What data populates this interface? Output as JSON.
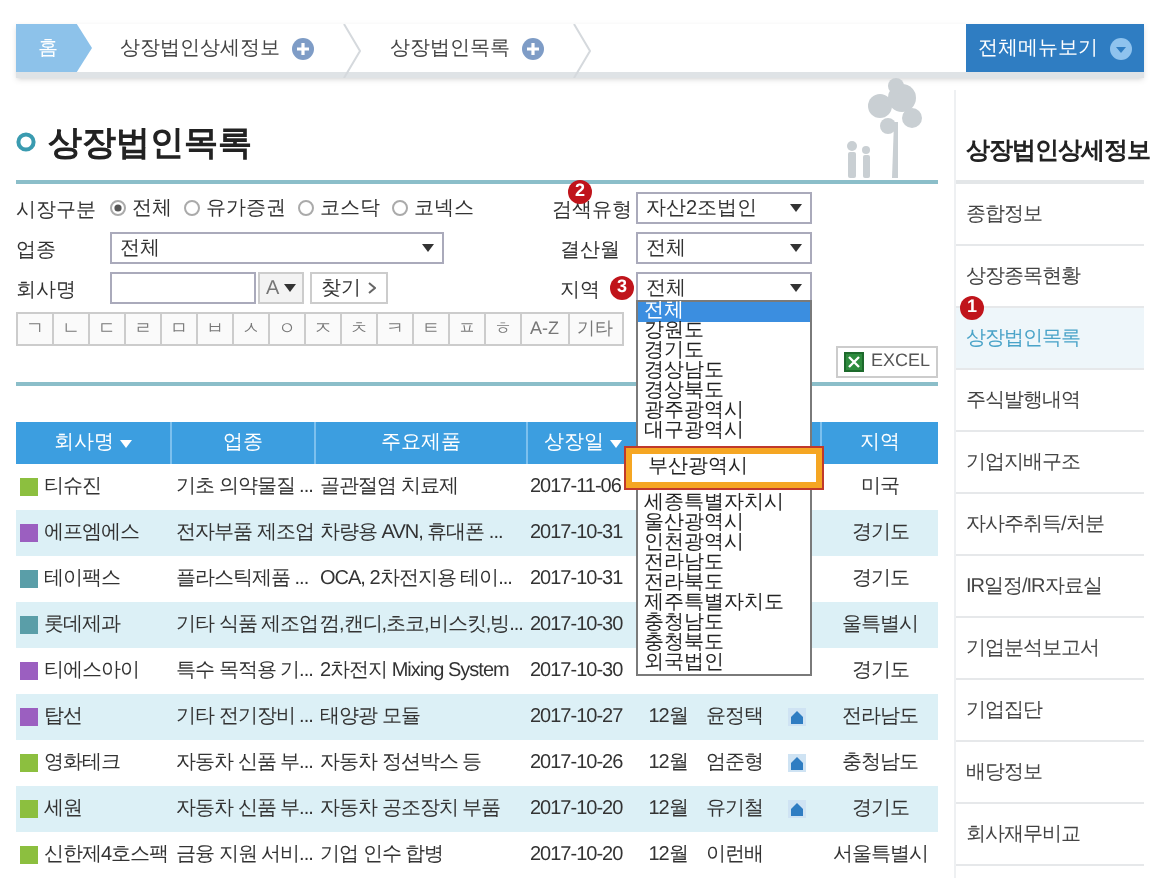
{
  "breadcrumb": {
    "home": "홈",
    "items": [
      {
        "label": "상장법인상세정보"
      },
      {
        "label": "상장법인목록"
      }
    ],
    "menu_button": "전체메뉴보기"
  },
  "page_title": "상장법인목록",
  "filters": {
    "market": {
      "label": "시장구분",
      "options": [
        {
          "label": "전체",
          "selected": true
        },
        {
          "label": "유가증권",
          "selected": false
        },
        {
          "label": "코스닥",
          "selected": false
        },
        {
          "label": "코넥스",
          "selected": false
        }
      ]
    },
    "search_type": {
      "label": "검색유형",
      "value": "자산2조법인"
    },
    "industry": {
      "label": "업종",
      "value": "전체"
    },
    "settlement_month": {
      "label": "결산월",
      "value": "전체"
    },
    "company_name": {
      "label": "회사명",
      "sort_key": "A",
      "search_button": "찾기"
    },
    "region": {
      "label": "지역",
      "value": "전체",
      "open": true,
      "options": [
        {
          "label": "전체",
          "selected": true,
          "highlighted": false
        },
        {
          "label": "강원도",
          "selected": false,
          "highlighted": false
        },
        {
          "label": "경기도",
          "selected": false,
          "highlighted": false
        },
        {
          "label": "경상남도",
          "selected": false,
          "highlighted": false
        },
        {
          "label": "경상북도",
          "selected": false,
          "highlighted": false
        },
        {
          "label": "광주광역시",
          "selected": false,
          "highlighted": false
        },
        {
          "label": "대구광역시",
          "selected": false,
          "highlighted": false
        },
        {
          "label": "부산광역시",
          "selected": false,
          "highlighted": true
        },
        {
          "label": "세종특별자치시",
          "selected": false,
          "highlighted": false
        },
        {
          "label": "울산광역시",
          "selected": false,
          "highlighted": false
        },
        {
          "label": "인천광역시",
          "selected": false,
          "highlighted": false
        },
        {
          "label": "전라남도",
          "selected": false,
          "highlighted": false
        },
        {
          "label": "전라북도",
          "selected": false,
          "highlighted": false
        },
        {
          "label": "제주특별자치도",
          "selected": false,
          "highlighted": false
        },
        {
          "label": "충청남도",
          "selected": false,
          "highlighted": false
        },
        {
          "label": "충청북도",
          "selected": false,
          "highlighted": false
        },
        {
          "label": "외국법인",
          "selected": false,
          "highlighted": false
        }
      ]
    }
  },
  "index_buttons": [
    "ㄱ",
    "ㄴ",
    "ㄷ",
    "ㄹ",
    "ㅁ",
    "ㅂ",
    "ㅅ",
    "ㅇ",
    "ㅈ",
    "ㅊ",
    "ㅋ",
    "ㅌ",
    "ㅍ",
    "ㅎ",
    "A-Z",
    "기타"
  ],
  "excel_button": "EXCEL",
  "table": {
    "columns": [
      {
        "label": "회사명",
        "sortable": true
      },
      {
        "label": "업종",
        "sortable": false
      },
      {
        "label": "주요제품",
        "sortable": false
      },
      {
        "label": "상장일",
        "sortable": true
      },
      {
        "label": "지역",
        "sortable": false
      }
    ],
    "rows": [
      {
        "name": "티슈진",
        "color": "#8cbf3f",
        "industry": "기초 의약물질 ...",
        "product": "골관절염 치료제",
        "listed_date": "2017-11-06",
        "region": "미국"
      },
      {
        "name": "에프엠에스",
        "color": "#9b5fc0",
        "industry": "전자부품 제조업",
        "product": "차량용 AVN, 휴대폰 ...",
        "listed_date": "2017-10-31",
        "region": "경기도"
      },
      {
        "name": "테이팩스",
        "color": "#5a9ea8",
        "industry": "플라스틱제품 ...",
        "product": "OCA, 2차전지용 테이...",
        "listed_date": "2017-10-31",
        "region": "경기도"
      },
      {
        "name": "롯데제과",
        "color": "#5a9ea8",
        "industry": "기타 식품 제조업",
        "product": "껌,캔디,초코,비스킷,빙...",
        "listed_date": "2017-10-30",
        "region": "울특별시"
      },
      {
        "name": "티에스아이",
        "color": "#9b5fc0",
        "industry": "특수 목적용 기...",
        "product": "2차전지 Mixing System",
        "listed_date": "2017-10-30",
        "region": "경기도"
      },
      {
        "name": "탑선",
        "color": "#9b5fc0",
        "industry": "기타 전기장비 ...",
        "product": "태양광 모듈",
        "listed_date": "2017-10-27",
        "settlement_month": "12월",
        "ceo": "윤정택",
        "homepage": true,
        "region": "전라남도"
      },
      {
        "name": "영화테크",
        "color": "#8cbf3f",
        "industry": "자동차 신품 부...",
        "product": "자동차 정션박스 등",
        "listed_date": "2017-10-26",
        "settlement_month": "12월",
        "ceo": "엄준형",
        "homepage": true,
        "region": "충청남도"
      },
      {
        "name": "세원",
        "color": "#8cbf3f",
        "industry": "자동차 신품 부...",
        "product": "자동차 공조장치 부품",
        "listed_date": "2017-10-20",
        "settlement_month": "12월",
        "ceo": "유기철",
        "homepage": true,
        "region": "경기도"
      },
      {
        "name": "신한제4호스팩",
        "color": "#8cbf3f",
        "industry": "금융 지원 서비...",
        "product": "기업 인수 합병",
        "listed_date": "2017-10-20",
        "settlement_month": "12월",
        "ceo": "이런배",
        "homepage": false,
        "region": "서울특별시"
      }
    ]
  },
  "sidebar": {
    "title": "상장법인상세정보",
    "items": [
      {
        "label": "종합정보",
        "selected": false
      },
      {
        "label": "상장종목현황",
        "selected": false
      },
      {
        "label": "상장법인목록",
        "selected": true
      },
      {
        "label": "주식발행내역",
        "selected": false
      },
      {
        "label": "기업지배구조",
        "selected": false
      },
      {
        "label": "자사주취득/처분",
        "selected": false
      },
      {
        "label": "IR일정/IR자료실",
        "selected": false
      },
      {
        "label": "기업분석보고서",
        "selected": false
      },
      {
        "label": "기업집단",
        "selected": false
      },
      {
        "label": "배당정보",
        "selected": false
      },
      {
        "label": "회사재무비교",
        "selected": false
      }
    ]
  },
  "markers": [
    {
      "number": "1"
    },
    {
      "number": "2"
    },
    {
      "number": "3"
    }
  ]
}
